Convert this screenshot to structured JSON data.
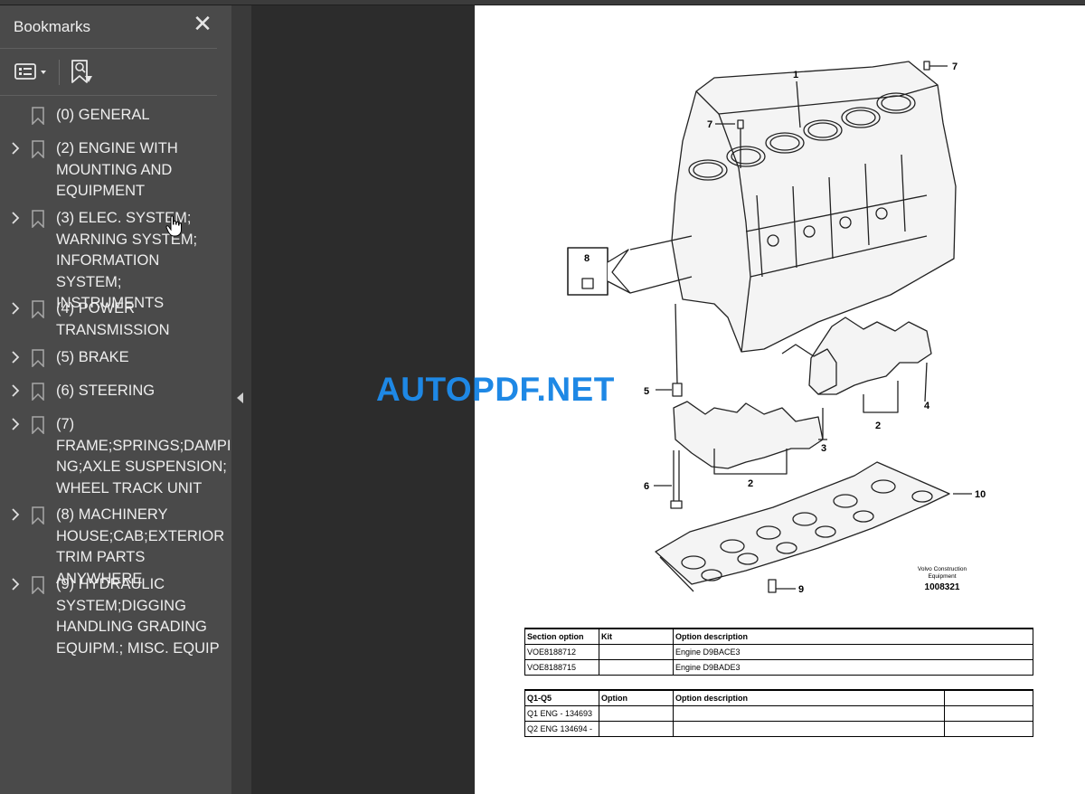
{
  "sidebar": {
    "title": "Bookmarks",
    "close_glyph": "✕",
    "toolbar": {
      "options_icon": "list-options-icon",
      "find_icon": "find-bookmark-icon"
    },
    "items": [
      {
        "label": "(0) GENERAL",
        "expandable": false
      },
      {
        "label": "(2) ENGINE WITH\nMOUNTING AND\nEQUIPMENT",
        "expandable": true
      },
      {
        "label": "(3) ELEC. SYSTEM;\nWARNING SYSTEM;\nINFORMATION SYSTEM;\nINSTRUMENTS",
        "expandable": true
      },
      {
        "label": "(4) POWER\nTRANSMISSION",
        "expandable": true
      },
      {
        "label": "(5) BRAKE",
        "expandable": true
      },
      {
        "label": "(6) STEERING",
        "expandable": true
      },
      {
        "label": "(7)\nFRAME;SPRINGS;DAMPI\nNG;AXLE SUSPENSION;\nWHEEL TRACK UNIT",
        "expandable": true
      },
      {
        "label": "(8) MACHINERY\nHOUSE;CAB;EXTERIOR\nTRIM PARTS ANYWHERE",
        "expandable": true
      },
      {
        "label": "(9) HYDRAULIC\nSYSTEM;DIGGING\nHANDLING GRADING\nEQUIPM.; MISC. EQUIP",
        "expandable": true
      }
    ]
  },
  "watermark": "AUTOPDF.NET",
  "drawing": {
    "callouts": [
      "1",
      "2",
      "2",
      "3",
      "4",
      "5",
      "6",
      "7",
      "7",
      "8",
      "9",
      "10"
    ],
    "maker_line1": "Volvo Construction",
    "maker_line2": "Equipment",
    "figure_number": "1008321"
  },
  "table1": {
    "headers": [
      "Section option",
      "Kit",
      "Option description"
    ],
    "rows": [
      [
        "VOE8188712",
        "",
        "Engine D9BACE3"
      ],
      [
        "VOE8188715",
        "",
        "Engine D9BADE3"
      ]
    ]
  },
  "table2": {
    "headers": [
      "Q1-Q5",
      "Option",
      "Option description",
      ""
    ],
    "rows": [
      [
        "Q1 ENG - 134693",
        "",
        "",
        ""
      ],
      [
        "Q2 ENG 134694 -",
        "",
        "",
        ""
      ]
    ]
  },
  "colors": {
    "sidebar_bg": "#4a4a4a",
    "viewer_bg": "#2c2c2c",
    "watermark": "#1e88e5"
  }
}
